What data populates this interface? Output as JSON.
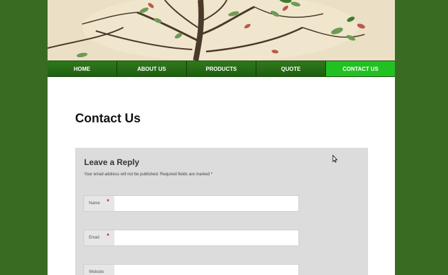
{
  "nav": {
    "items": [
      {
        "label": "HOME",
        "active": false
      },
      {
        "label": "ABOUT US",
        "active": false
      },
      {
        "label": "PRODUCTS",
        "active": false
      },
      {
        "label": "QUOTE",
        "active": false
      },
      {
        "label": "CONTACT US",
        "active": true
      }
    ]
  },
  "page": {
    "title": "Contact Us"
  },
  "reply": {
    "title": "Leave a Reply",
    "note": "Your email address will not be published. Required fields are marked *",
    "fields": [
      {
        "label": "Name",
        "required": true,
        "value": ""
      },
      {
        "label": "Email",
        "required": true,
        "value": ""
      },
      {
        "label": "Website",
        "required": false,
        "value": ""
      }
    ],
    "required_marker": "*"
  },
  "colors": {
    "background": "#3a6b22",
    "nav": "#1f5e10",
    "nav_active": "#22c122",
    "form_bg": "#dcdcdc",
    "required": "#cc1f1f"
  },
  "icons": {
    "banner": "bonsai-tree-photo",
    "cursor": "mouse-pointer-icon"
  }
}
